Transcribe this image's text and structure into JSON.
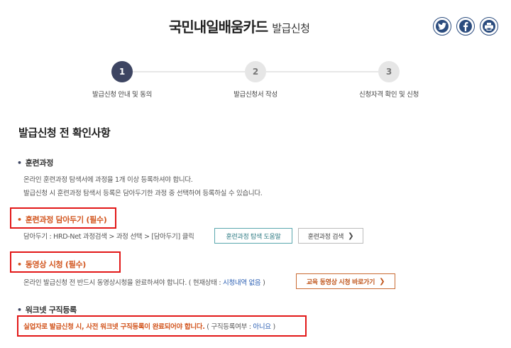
{
  "header": {
    "title_main": "국민내일배움카드",
    "title_sub": "발급신청",
    "share": [
      {
        "name": "twitter-icon",
        "glyph": "t"
      },
      {
        "name": "facebook-icon",
        "glyph": "f"
      },
      {
        "name": "print-icon",
        "glyph": ""
      }
    ]
  },
  "stepper": {
    "steps": [
      {
        "number": "1",
        "label": "발급신청 안내 및 동의",
        "active": true
      },
      {
        "number": "2",
        "label": "발급신청서 작성",
        "active": false
      },
      {
        "number": "3",
        "label": "신청자격 확인 및 신청",
        "active": false
      }
    ]
  },
  "main": {
    "section_title": "발급신청 전 확인사항",
    "course": {
      "title": "훈련과정",
      "line1": "온라인 훈련과정 탐색서에 과정을 1개 이상 등록하셔야 합니다.",
      "line2": "발급신청 시 훈련과정 탐색서 등록은 담아두기한 과정 중 선택하여 등록하실 수 있습니다."
    },
    "save_course": {
      "title": "훈련과정 담아두기 (필수)",
      "desc": "담아두기 : HRD-Net 과정검색 > 과정 선택 > [담아두기] 클릭",
      "help_button": "훈련과정 탐색 도움말",
      "search_button": "훈련과정 검색"
    },
    "video": {
      "title": "동영상 시청 (필수)",
      "desc": "온라인 발급신청 전 반드시 동영상시청을 완료하셔야 합니다. ( 현재상태 : ",
      "status": "시청내역 없음",
      "desc_end": " )",
      "button": "교육 동영상 시청 바로가기"
    },
    "worknet": {
      "title": "워크넷 구직등록",
      "notice": "실업자로 발급신청 시, 사전 워크넷 구직등록이 완료되어야 합니다.",
      "status_prefix": " ( 구직등록여부 : ",
      "status": "아니요",
      "status_suffix": " )"
    }
  }
}
